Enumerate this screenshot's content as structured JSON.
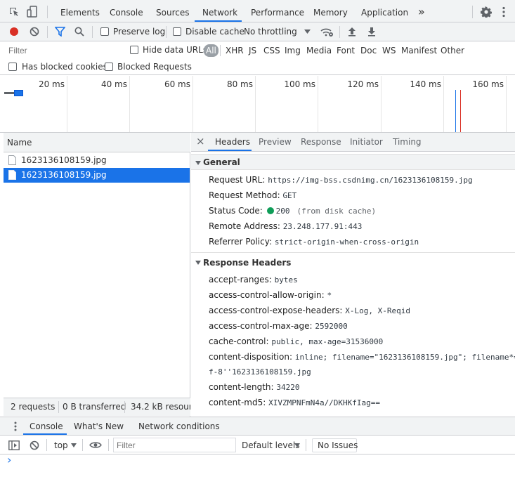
{
  "tabs": {
    "elements": "Elements",
    "console": "Console",
    "sources": "Sources",
    "network": "Network",
    "performance": "Performance",
    "memory": "Memory",
    "application": "Application",
    "more": "»"
  },
  "toolbar": {
    "preserve_log": "Preserve log",
    "disable_cache": "Disable cache",
    "throttling": "No throttling"
  },
  "filterbar": {
    "placeholder": "Filter",
    "hide_data_urls": "Hide data URLs",
    "types": [
      "All",
      "XHR",
      "JS",
      "CSS",
      "Img",
      "Media",
      "Font",
      "Doc",
      "WS",
      "Manifest",
      "Other"
    ],
    "has_blocked_cookies": "Has blocked cookies",
    "blocked_requests": "Blocked Requests"
  },
  "overview": {
    "ticks": [
      "20 ms",
      "40 ms",
      "60 ms",
      "80 ms",
      "100 ms",
      "120 ms",
      "140 ms",
      "160 ms"
    ]
  },
  "request_list": {
    "header": "Name",
    "items": [
      "1623136108159.jpg",
      "1623136108159.jpg"
    ],
    "summary": {
      "requests": "2 requests",
      "transferred": "0 B transferred",
      "resources": "34.2 kB resourc"
    }
  },
  "details": {
    "close": "×",
    "tabs": [
      "Headers",
      "Preview",
      "Response",
      "Initiator",
      "Timing"
    ],
    "general_title": "General",
    "general": [
      {
        "k": "Request URL:",
        "v": "https://img-bss.csdnimg.cn/1623136108159.jpg"
      },
      {
        "k": "Request Method:",
        "v": "GET"
      },
      {
        "k": "Status Code:",
        "v": "200",
        "note": "(from disk cache)"
      },
      {
        "k": "Remote Address:",
        "v": "23.248.177.91:443"
      },
      {
        "k": "Referrer Policy:",
        "v": "strict-origin-when-cross-origin"
      }
    ],
    "response_title": "Response Headers",
    "response": [
      {
        "k": "accept-ranges:",
        "v": "bytes"
      },
      {
        "k": "access-control-allow-origin:",
        "v": "*"
      },
      {
        "k": "access-control-expose-headers:",
        "v": "X-Log, X-Reqid"
      },
      {
        "k": "access-control-max-age:",
        "v": "2592000"
      },
      {
        "k": "cache-control:",
        "v": "public, max-age=31536000"
      },
      {
        "k": "content-disposition:",
        "v": "inline; filename=\"1623136108159.jpg\"; filename*=",
        "v2": "f-8''1623136108159.jpg"
      },
      {
        "k": "content-length:",
        "v": "34220"
      },
      {
        "k": "content-md5:",
        "v": "XIVZMPNFmN4a//DKHKfIag=="
      }
    ]
  },
  "drawer": {
    "tabs": [
      "Console",
      "What's New",
      "Network conditions"
    ],
    "context": "top",
    "filter_placeholder": "Filter",
    "levels": "Default levels",
    "issues": "No Issues",
    "prompt": "›"
  },
  "colors": {
    "accent": "#1a73e8",
    "selected_row": "#1a73e8",
    "record": "#d93025",
    "status_ok": "#0f9d58"
  }
}
